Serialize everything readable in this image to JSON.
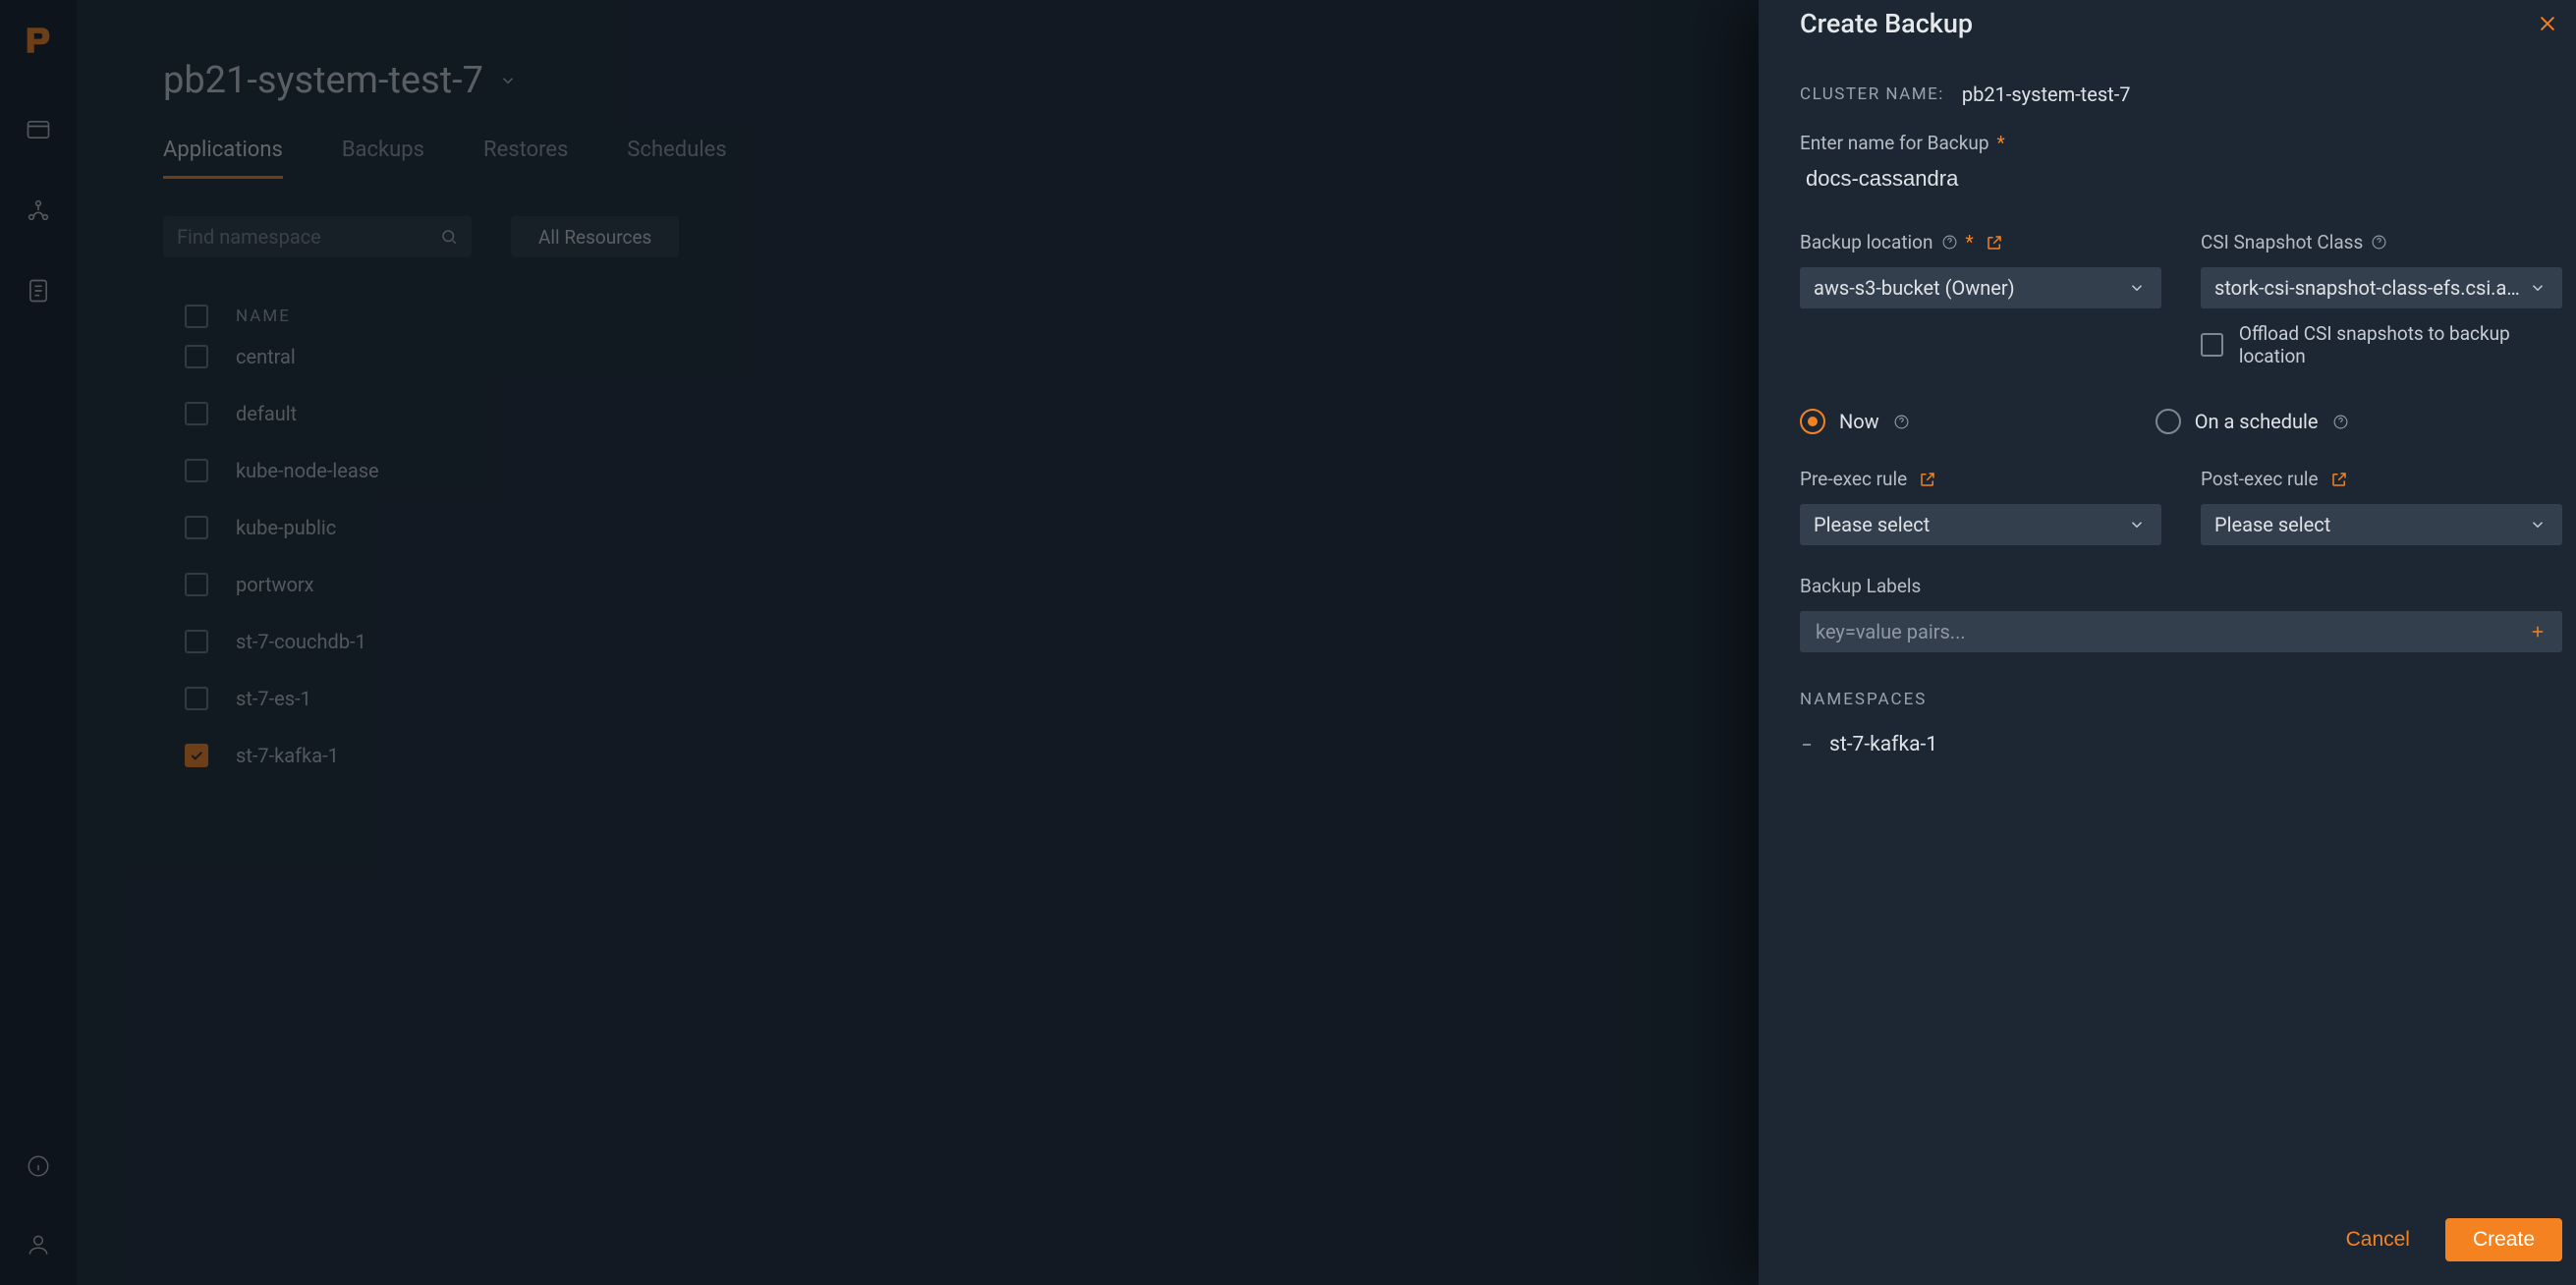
{
  "page": {
    "title": "pb21-system-test-7",
    "tabs": [
      "Applications",
      "Backups",
      "Restores",
      "Schedules"
    ],
    "active_tab": 0,
    "search_placeholder": "Find namespace",
    "filter": "All Resources",
    "name_col": "NAME",
    "namespaces": [
      {
        "name": "central",
        "checked": false
      },
      {
        "name": "default",
        "checked": false
      },
      {
        "name": "kube-node-lease",
        "checked": false
      },
      {
        "name": "kube-public",
        "checked": false
      },
      {
        "name": "portworx",
        "checked": false
      },
      {
        "name": "st-7-couchdb-1",
        "checked": false
      },
      {
        "name": "st-7-es-1",
        "checked": false
      },
      {
        "name": "st-7-kafka-1",
        "checked": true
      }
    ]
  },
  "drawer": {
    "title": "Create Backup",
    "cluster_label": "CLUSTER NAME:",
    "cluster_name": "pb21-system-test-7",
    "name_label": "Enter name for Backup",
    "name_value": "docs-cassandra",
    "backup_location_label": "Backup location",
    "backup_location_value": "aws-s3-bucket (Owner)",
    "csi_label": "CSI Snapshot Class",
    "csi_value": "stork-csi-snapshot-class-efs.csi.aws",
    "offload_label": "Offload CSI snapshots to backup location",
    "radio_now": "Now",
    "radio_schedule": "On a schedule",
    "pre_exec_label": "Pre-exec rule",
    "post_exec_label": "Post-exec rule",
    "select_placeholder": "Please select",
    "backup_labels_label": "Backup Labels",
    "labels_placeholder": "key=value pairs...",
    "namespaces_label": "NAMESPACES",
    "ns_items": [
      "st-7-kafka-1"
    ],
    "cancel": "Cancel",
    "create": "Create"
  }
}
